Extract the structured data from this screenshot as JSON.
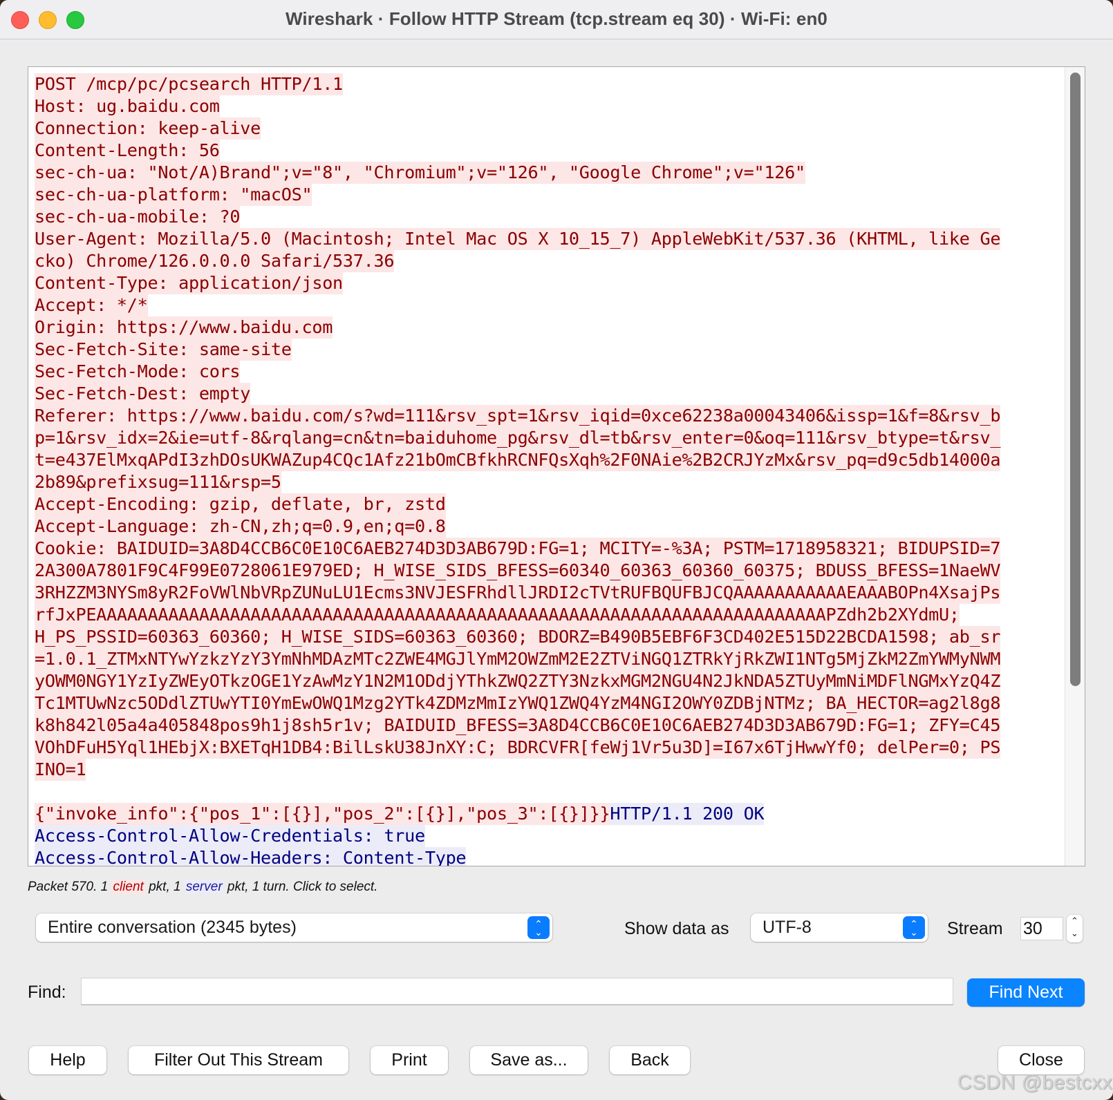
{
  "window": {
    "title": "Wireshark · Follow HTTP Stream (tcp.stream eq 30) · Wi-Fi: en0",
    "buttons": [
      "close",
      "minimize",
      "zoom"
    ]
  },
  "colors": {
    "client_text": "#8b0000",
    "client_bg": "#fce6e6",
    "server_text": "#00007f",
    "server_bg": "#ececf9",
    "accent": "#0a84ff"
  },
  "stream": {
    "lines": [
      [
        {
          "side": "client",
          "text": "POST /mcp/pc/pcsearch HTTP/1.1"
        }
      ],
      [
        {
          "side": "client",
          "text": "Host: ug.baidu.com"
        }
      ],
      [
        {
          "side": "client",
          "text": "Connection: keep-alive"
        }
      ],
      [
        {
          "side": "client",
          "text": "Content-Length: 56"
        }
      ],
      [
        {
          "side": "client",
          "text": "sec-ch-ua: \"Not/A)Brand\";v=\"8\", \"Chromium\";v=\"126\", \"Google Chrome\";v=\"126\""
        }
      ],
      [
        {
          "side": "client",
          "text": "sec-ch-ua-platform: \"macOS\""
        }
      ],
      [
        {
          "side": "client",
          "text": "sec-ch-ua-mobile: ?0"
        }
      ],
      [
        {
          "side": "client",
          "text": "User-Agent: Mozilla/5.0 (Macintosh; Intel Mac OS X 10_15_7) AppleWebKit/537.36 (KHTML, like Ge"
        }
      ],
      [
        {
          "side": "client",
          "text": "cko) Chrome/126.0.0.0 Safari/537.36"
        }
      ],
      [
        {
          "side": "client",
          "text": "Content-Type: application/json"
        }
      ],
      [
        {
          "side": "client",
          "text": "Accept: */*"
        }
      ],
      [
        {
          "side": "client",
          "text": "Origin: https://www.baidu.com"
        }
      ],
      [
        {
          "side": "client",
          "text": "Sec-Fetch-Site: same-site"
        }
      ],
      [
        {
          "side": "client",
          "text": "Sec-Fetch-Mode: cors"
        }
      ],
      [
        {
          "side": "client",
          "text": "Sec-Fetch-Dest: empty"
        }
      ],
      [
        {
          "side": "client",
          "text": "Referer: https://www.baidu.com/s?wd=111&rsv_spt=1&rsv_iqid=0xce62238a00043406&issp=1&f=8&rsv_b"
        }
      ],
      [
        {
          "side": "client",
          "text": "p=1&rsv_idx=2&ie=utf-8&rqlang=cn&tn=baiduhome_pg&rsv_dl=tb&rsv_enter=0&oq=111&rsv_btype=t&rsv_"
        }
      ],
      [
        {
          "side": "client",
          "text": "t=e437ElMxqAPdI3zhDOsUKWAZup4CQc1Afz21bOmCBfkhRCNFQsXqh%2F0NAie%2B2CRJYzMx&rsv_pq=d9c5db14000a"
        }
      ],
      [
        {
          "side": "client",
          "text": "2b89&prefixsug=111&rsp=5"
        }
      ],
      [
        {
          "side": "client",
          "text": "Accept-Encoding: gzip, deflate, br, zstd"
        }
      ],
      [
        {
          "side": "client",
          "text": "Accept-Language: zh-CN,zh;q=0.9,en;q=0.8"
        }
      ],
      [
        {
          "side": "client",
          "text": "Cookie: BAIDUID=3A8D4CCB6C0E10C6AEB274D3D3AB679D:FG=1; MCITY=-%3A; PSTM=1718958321; BIDUPSID=7"
        }
      ],
      [
        {
          "side": "client",
          "text": "2A300A7801F9C4F99E0728061E979ED; H_WISE_SIDS_BFESS=60340_60363_60360_60375; BDUSS_BFESS=1NaeWV"
        }
      ],
      [
        {
          "side": "client",
          "text": "3RHZZM3NYSm8yR2FoVWlNbVRpZUNuLU1Ecms3NVJESFRhdllJRDI2cTVtRUFBQUFBJCQAAAAAAAAAAAEAAABOPn4XsajPs"
        }
      ],
      [
        {
          "side": "client",
          "text": "rfJxPEAAAAAAAAAAAAAAAAAAAAAAAAAAAAAAAAAAAAAAAAAAAAAAAAAAAAAAAAAAAAAAAAAAAAAAAPZdh2b2XYdmU;"
        }
      ],
      [
        {
          "side": "client",
          "text": "H_PS_PSSID=60363_60360; H_WISE_SIDS=60363_60360; BDORZ=B490B5EBF6F3CD402E515D22BCDA1598; ab_sr"
        }
      ],
      [
        {
          "side": "client",
          "text": "=1.0.1_ZTMxNTYwYzkzYzY3YmNhMDAzMTc2ZWE4MGJlYmM2OWZmM2E2ZTViNGQ1ZTRkYjRkZWI1NTg5MjZkM2ZmYWMyNWM"
        }
      ],
      [
        {
          "side": "client",
          "text": "yOWM0NGY1YzIyZWEyOTkzOGE1YzAwMzY1N2M1ODdjYThkZWQ2ZTY3NzkxMGM2NGU4N2JkNDA5ZTUyMmNiMDFlNGMxYzQ4Z"
        }
      ],
      [
        {
          "side": "client",
          "text": "Tc1MTUwNzc5ODdlZTUwYTI0YmEwOWQ1Mzg2YTk4ZDMzMmIzYWQ1ZWQ4YzM4NGI2OWY0ZDBjNTMz; BA_HECTOR=ag2l8g8"
        }
      ],
      [
        {
          "side": "client",
          "text": "k8h842l05a4a405848pos9h1j8sh5r1v; BAIDUID_BFESS=3A8D4CCB6C0E10C6AEB274D3D3AB679D:FG=1; ZFY=C45"
        }
      ],
      [
        {
          "side": "client",
          "text": "VOhDFuH5Yql1HEbjX:BXETqH1DB4:BilLskU38JnXY:C; BDRCVFR[feWj1Vr5u3D]=I67x6TjHwwYf0; delPer=0; PS"
        }
      ],
      [
        {
          "side": "client",
          "text": "INO=1"
        }
      ],
      [
        {
          "side": "blank",
          "text": ""
        }
      ],
      [
        {
          "side": "client",
          "text": "{\"invoke_info\":{\"pos_1\":[{}],\"pos_2\":[{}],\"pos_3\":[{}]}}"
        },
        {
          "side": "server",
          "text": "HTTP/1.1 200 OK"
        }
      ],
      [
        {
          "side": "server",
          "text": "Access-Control-Allow-Credentials: true"
        }
      ],
      [
        {
          "side": "server",
          "text": "Access-Control-Allow-Headers: Content-Type"
        }
      ]
    ]
  },
  "status": {
    "prefix": "Packet 570. 1 ",
    "client_word": "client",
    "mid": " pkt, 1 ",
    "server_word": "server",
    "suffix": " pkt, 1 turn. Click to select."
  },
  "controls": {
    "conversation_select": "Entire conversation (2345 bytes)",
    "show_data_as_label": "Show data as",
    "show_data_as_value": "UTF-8",
    "stream_label": "Stream",
    "stream_value": "30",
    "stepper_up": "⌃",
    "stepper_down": "⌄"
  },
  "find": {
    "label": "Find:",
    "value": "",
    "placeholder": "",
    "button": "Find Next"
  },
  "buttons": {
    "help": "Help",
    "filter_out": "Filter Out This Stream",
    "print": "Print",
    "save_as": "Save as...",
    "back": "Back",
    "close": "Close"
  },
  "watermark": "CSDN @bestcxx"
}
